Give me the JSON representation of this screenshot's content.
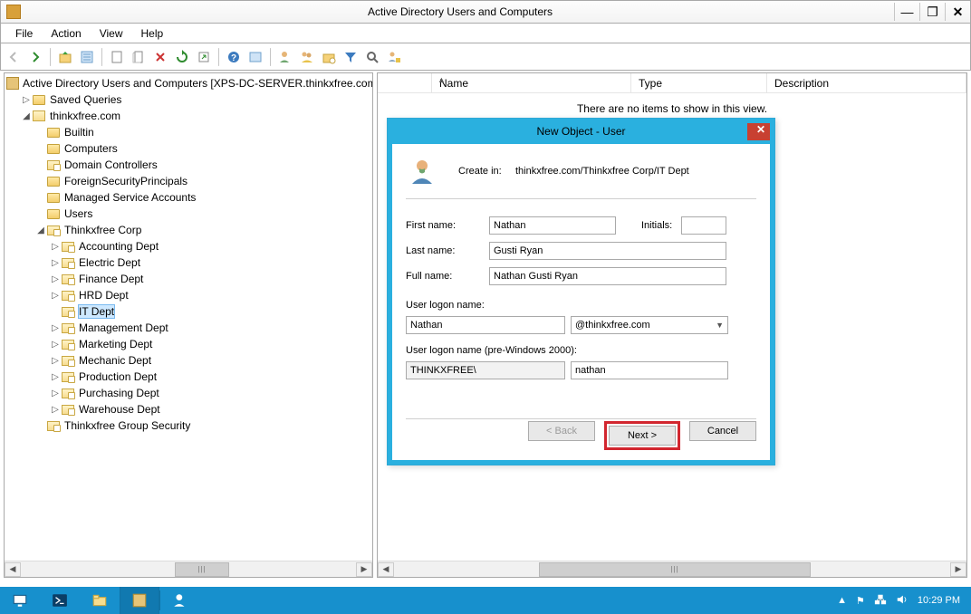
{
  "window": {
    "title": "Active Directory Users and Computers"
  },
  "menu": {
    "file": "File",
    "action": "Action",
    "view": "View",
    "help": "Help"
  },
  "tree": {
    "root": "Active Directory Users and Computers [XPS-DC-SERVER.thinkxfree.com]",
    "saved": "Saved Queries",
    "domain": "thinkxfree.com",
    "builtin": "Builtin",
    "computers": "Computers",
    "dcs": "Domain Controllers",
    "fsp": "ForeignSecurityPrincipals",
    "msa": "Managed Service Accounts",
    "users": "Users",
    "corp": "Thinkxfree Corp",
    "depts": {
      "acct": "Accounting Dept",
      "elec": "Electric Dept",
      "fin": "Finance Dept",
      "hrd": "HRD Dept",
      "it": "IT Dept",
      "mgmt": "Management Dept",
      "mkt": "Marketing Dept",
      "mech": "Mechanic Dept",
      "prod": "Production Dept",
      "purch": "Purchasing Dept",
      "ware": "Warehouse Dept"
    },
    "groupsec": "Thinkxfree Group Security"
  },
  "list": {
    "col_name": "Name",
    "col_type": "Type",
    "col_desc": "Description",
    "empty": "There are no items to show in this view."
  },
  "dialog": {
    "title": "New Object - User",
    "create_in_label": "Create in:",
    "create_in_path": "thinkxfree.com/Thinkxfree Corp/IT Dept",
    "first_lbl": "First name:",
    "first_val": "Nathan",
    "initials_lbl": "Initials:",
    "initials_val": "",
    "last_lbl": "Last name:",
    "last_val": "Gusti Ryan",
    "full_lbl": "Full name:",
    "full_val": "Nathan Gusti Ryan",
    "logon_lbl": "User logon name:",
    "logon_val": "Nathan",
    "upn_suffix": "@thinkxfree.com",
    "logon2k_lbl": "User logon name (pre-Windows 2000):",
    "domain_prefix": "THINKXFREE\\",
    "logon2k_val": "nathan",
    "back": "< Back",
    "next": "Next >",
    "cancel": "Cancel"
  },
  "tray": {
    "time": "10:29 PM"
  }
}
